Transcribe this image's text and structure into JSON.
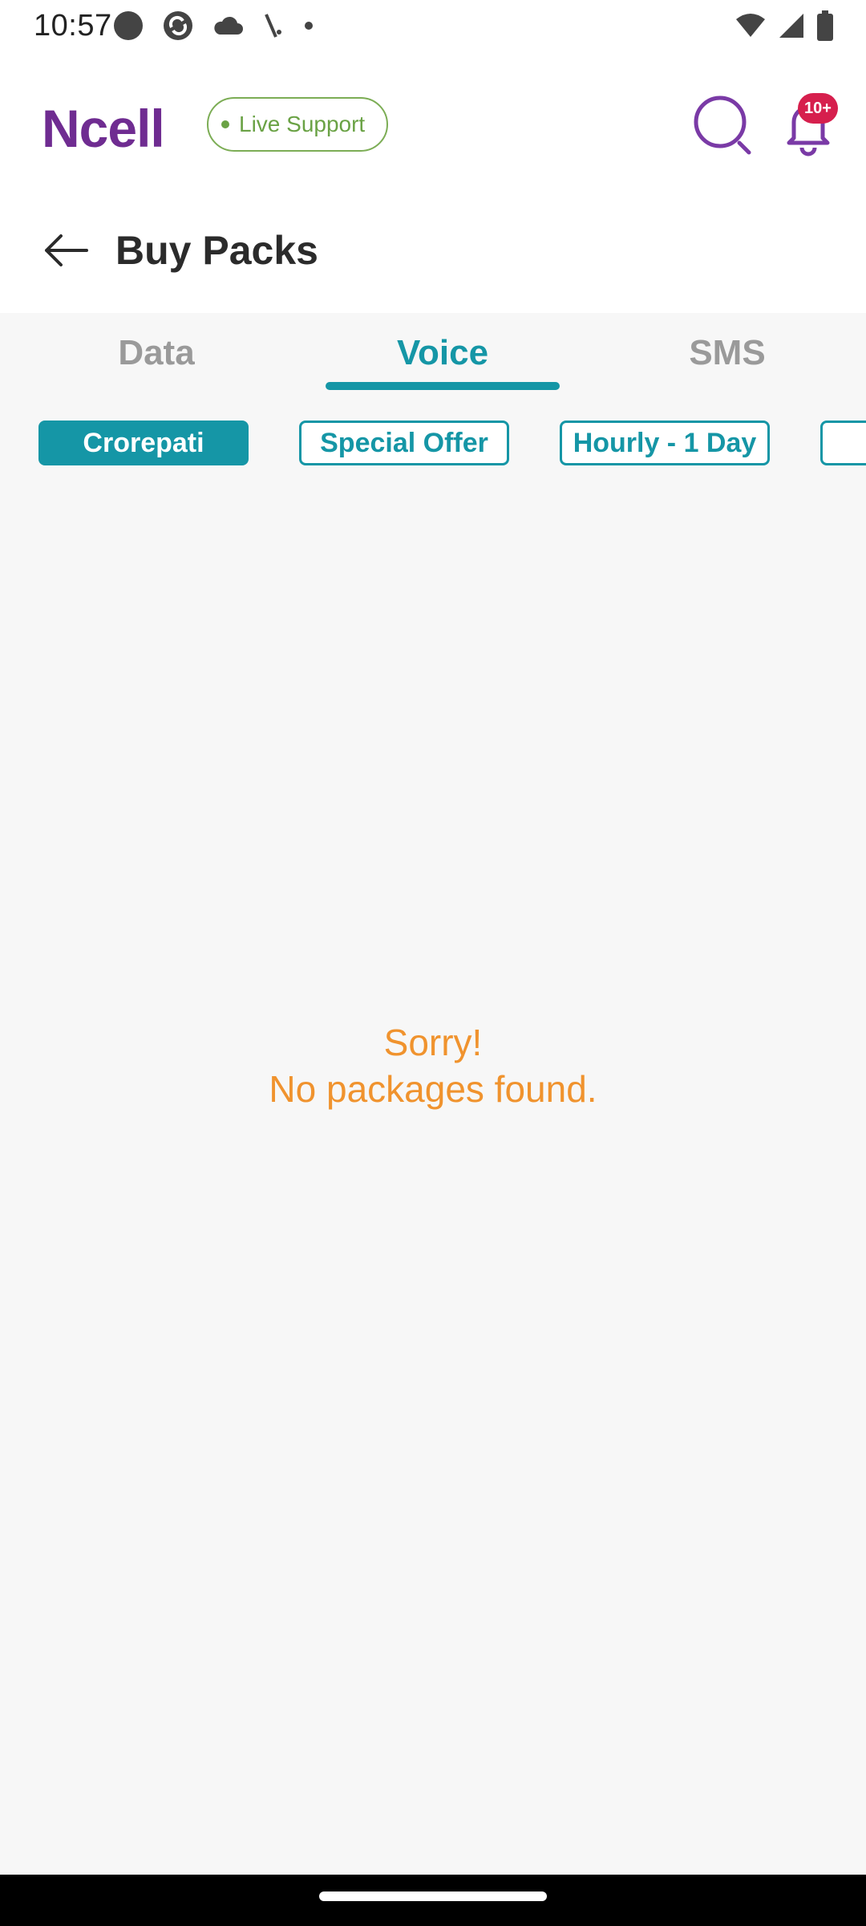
{
  "status_bar": {
    "time": "10:57",
    "left_icons": [
      "record-icon",
      "sync-icon",
      "cloud-icon",
      "signal-slash-icon",
      "dot-icon"
    ],
    "right_icons": [
      "wifi-icon",
      "cell-signal-icon",
      "battery-icon"
    ]
  },
  "header": {
    "brand": "Ncell",
    "live_support_label": "Live Support",
    "notification_count": "10+",
    "title": "Buy Packs"
  },
  "tabs": [
    {
      "label": "Data",
      "active": false
    },
    {
      "label": "Voice",
      "active": true
    },
    {
      "label": "SMS",
      "active": false
    }
  ],
  "chips": [
    {
      "label": "Crorepati",
      "active": true
    },
    {
      "label": "Special Offer",
      "active": false
    },
    {
      "label": "Hourly - 1 Day",
      "active": false
    },
    {
      "label": "",
      "active": false
    }
  ],
  "empty_state": {
    "line1": "Sorry!",
    "line2": "No packages found."
  },
  "colors": {
    "brand_purple": "#6f2c91",
    "accent_teal": "#1596a6",
    "live_green": "#6aa245",
    "badge_red": "#d61f4d",
    "empty_orange": "#f0932e"
  }
}
